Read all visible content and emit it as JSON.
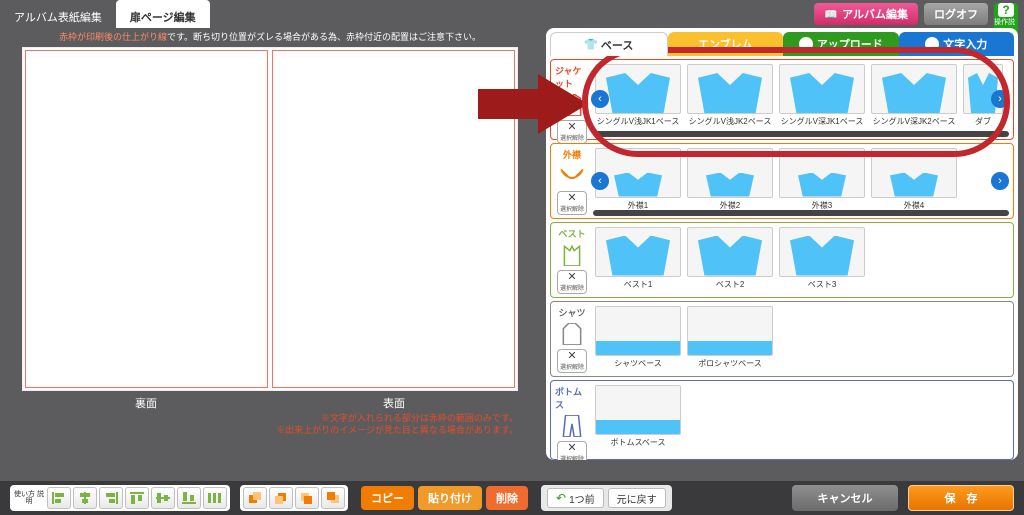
{
  "tabs": {
    "cover": "アルバム表紙編集",
    "spread": "扉ページ編集"
  },
  "topbar": {
    "album_edit": "アルバム編集",
    "logoff": "ログオフ",
    "help_label": "操作説明"
  },
  "notice": {
    "red_pre": "赤枠が印刷後の仕上がり線",
    "rest": "です。断ち切り位置がズレる場合がある為、赤枠付近の配置はご注意下さい。"
  },
  "page_labels": {
    "back": "裏面",
    "front": "表面"
  },
  "foot_notes": {
    "l1": "※文字が入れられる部分は赤枠の範囲のみです。",
    "l2": "※出来上がりのイメージが見た目と異なる場合があります。"
  },
  "cat_tabs": {
    "base": "ベース",
    "t2": "エンブレム",
    "t3": "アップロード",
    "t4": "文字入力"
  },
  "clear_label": "選択解除",
  "sections": {
    "jacket": {
      "title": "ジャケット",
      "items": [
        "シングルV浅JK1ベース",
        "シングルV浅JK2ベース",
        "シングルV深JK1ベース",
        "シングルV深JK2ベース",
        "ダブ"
      ]
    },
    "outer": {
      "title": "外襟",
      "items": [
        "外襟1",
        "外襟2",
        "外襟3",
        "外襟4"
      ]
    },
    "vest": {
      "title": "ベスト",
      "items": [
        "ベスト1",
        "ベスト2",
        "ベスト3"
      ]
    },
    "shirt": {
      "title": "シャツ",
      "items": [
        "シャツベース",
        "ポロシャツベース"
      ]
    },
    "bottoms": {
      "title": "ボトムス",
      "items": [
        "ボトムスベース"
      ]
    }
  },
  "toolbar": {
    "howto": "使い方 説明",
    "copy": "コピー",
    "paste": "貼り付け",
    "delete": "削除",
    "undo": "1つ前",
    "reset": "元に戻す",
    "cancel": "キャンセル",
    "save": "保　存"
  }
}
